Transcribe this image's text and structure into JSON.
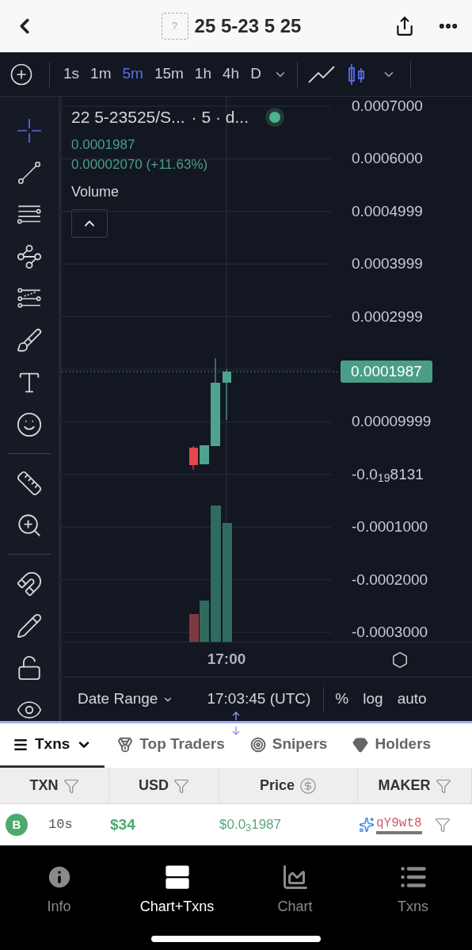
{
  "header": {
    "token_icon": "?",
    "title": "25 5-23 5 25"
  },
  "toolbar": {
    "timeframes": [
      {
        "label": "1s",
        "selected": false
      },
      {
        "label": "1m",
        "selected": false
      },
      {
        "label": "5m",
        "selected": true
      },
      {
        "label": "15m",
        "selected": false
      },
      {
        "label": "1h",
        "selected": false
      },
      {
        "label": "4h",
        "selected": false
      },
      {
        "label": "D",
        "selected": false
      }
    ],
    "chart_types": [
      {
        "kind": "line",
        "selected": false
      },
      {
        "kind": "candles",
        "selected": true
      }
    ]
  },
  "tool_groups": [
    {
      "tools": [
        {
          "kind": "crosshair",
          "selected": true
        },
        {
          "kind": "trend-line",
          "selected": false
        },
        {
          "kind": "parallel-lines",
          "selected": false
        },
        {
          "kind": "pattern",
          "selected": false
        },
        {
          "kind": "fib",
          "selected": false
        },
        {
          "kind": "brush",
          "selected": false
        },
        {
          "kind": "text",
          "selected": false
        },
        {
          "kind": "emoji",
          "selected": false
        }
      ]
    },
    {
      "tools": [
        {
          "kind": "ruler",
          "selected": false
        },
        {
          "kind": "zoom",
          "selected": false
        }
      ]
    },
    {
      "tools": [
        {
          "kind": "magnet",
          "selected": false
        },
        {
          "kind": "lock-drawing",
          "selected": false
        },
        {
          "kind": "unlock",
          "selected": false
        },
        {
          "kind": "eye",
          "selected": false
        }
      ]
    }
  ],
  "legend": {
    "symbol": "22 5-23525/S...",
    "interval": "· 5 · d...",
    "live": true,
    "price": "0.0001987",
    "change": "0.00002070 (+11.63%)",
    "volume_label": "Volume"
  },
  "price_axis": [
    "0.0007000",
    "0.0006000",
    "0.0004999",
    "0.0003999",
    "0.0002999",
    "0.00009999",
    "-0.0$_{19}$8131",
    "-0.0001000",
    "-0.0002000",
    "-0.0003000"
  ],
  "last_price": "0.0001987",
  "time_axis": [
    "17:00"
  ],
  "footer": {
    "date_range": "Date Range",
    "time": "17:03:45 (UTC)",
    "options": [
      "%",
      "log",
      "auto"
    ]
  },
  "tabs": [
    {
      "label": "Txns",
      "kind": "menu",
      "selected": true
    },
    {
      "label": "Top Traders",
      "kind": "medal",
      "selected": false
    },
    {
      "label": "Snipers",
      "kind": "target",
      "selected": false
    },
    {
      "label": "Holders",
      "kind": "gem",
      "selected": false
    }
  ],
  "table": {
    "columns": [
      {
        "label": "TXN"
      },
      {
        "label": "USD"
      },
      {
        "label": "Price"
      },
      {
        "label": "MAKER"
      }
    ],
    "rows": [
      {
        "type": "B",
        "age": "10s",
        "usd": "$34",
        "price": "$0.0$_{3}$1987",
        "maker": "qY9wt8"
      }
    ]
  },
  "nav": [
    {
      "label": "Info",
      "kind": "info",
      "selected": false
    },
    {
      "label": "Chart+Txns",
      "kind": "split",
      "selected": true
    },
    {
      "label": "Chart",
      "kind": "chart",
      "selected": false
    },
    {
      "label": "Txns",
      "kind": "list",
      "selected": false
    }
  ]
}
